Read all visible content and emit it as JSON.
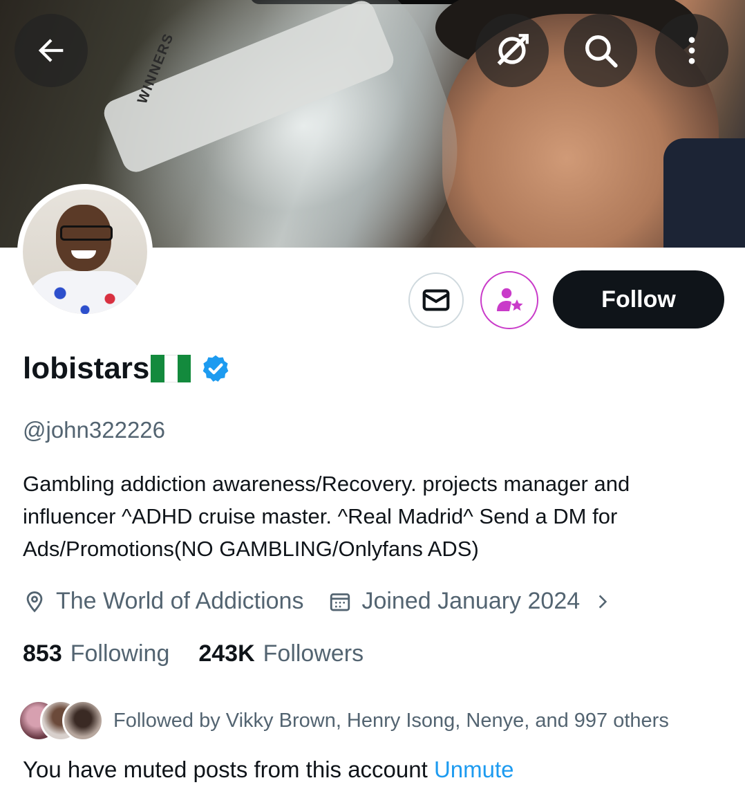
{
  "banner": {
    "trophy_text": "WINNERS"
  },
  "header_buttons": {
    "back_icon": "arrow-left-icon",
    "grok_icon": "grok-icon",
    "search_icon": "search-icon",
    "more_icon": "more-vertical-icon"
  },
  "actions": {
    "message_icon": "envelope-icon",
    "subscribe_icon": "person-star-icon",
    "follow_label": "Follow",
    "subscribe_color": "#c93bc9"
  },
  "profile": {
    "display_name": "lobistars",
    "flag": "Nigeria",
    "verified_color": "#1d9bf0",
    "handle": "@john322226",
    "bio": "Gambling addiction awareness/Recovery. projects manager and influencer ^ADHD cruise master. ^Real Madrid^ Send a DM for Ads/Promotions(NO GAMBLING/Onlyfans ADS)",
    "location": "The World of Addictions",
    "joined": "Joined January 2024"
  },
  "stats": {
    "following_count": "853",
    "following_label": "Following",
    "followers_count": "243K",
    "followers_label": "Followers"
  },
  "followed_by": "Followed by Vikky Brown, Henry Isong, Nenye, and 997 others",
  "muted": {
    "text": "You have muted posts from this account",
    "unmute_label": "Unmute"
  }
}
